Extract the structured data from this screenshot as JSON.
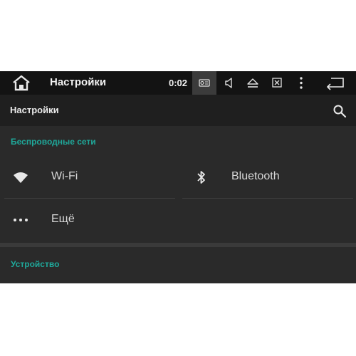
{
  "statusbar": {
    "title": "Настройки",
    "time": "0:02",
    "icons": [
      "home-icon",
      "radio-icon",
      "volume-icon",
      "eject-icon",
      "close-window-icon",
      "more-vert-icon",
      "back-icon"
    ]
  },
  "appbar": {
    "title": "Настройки",
    "search_icon": "search-icon"
  },
  "sections": [
    {
      "header": "Беспроводные сети",
      "items": [
        {
          "label": "Wi-Fi",
          "icon": "wifi-icon"
        },
        {
          "label": "Bluetooth",
          "icon": "bluetooth-icon"
        },
        {
          "label": "Ещё",
          "icon": "more-horiz-icon"
        }
      ]
    },
    {
      "header": "Устройство"
    }
  ],
  "colors": {
    "accent": "#1fa89a",
    "background": "#2a2a2a",
    "statusbar": "#131313",
    "appbar": "#1f1f1f"
  }
}
